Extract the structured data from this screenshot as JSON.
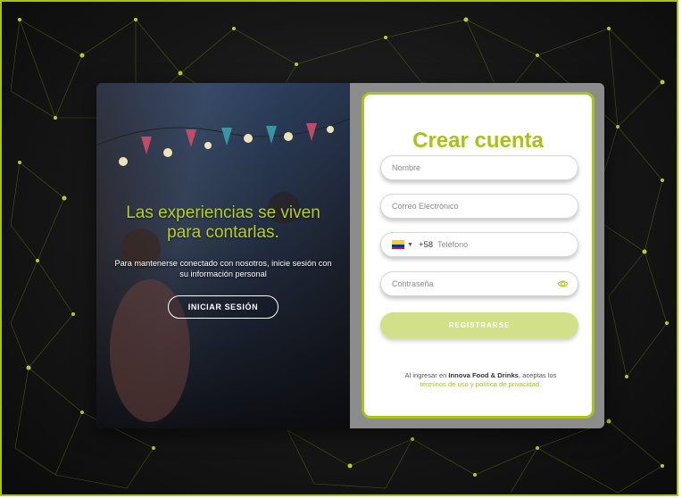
{
  "colors": {
    "accent": "#a9c21a",
    "button_disabled": "#d3e08a",
    "background": "#161616"
  },
  "hero": {
    "tagline": "Las experiencias se viven para contarlas.",
    "subtitle": "Para mantenerse conectado con nosotros, inicie sesión con su información personal",
    "login_button": "INICIAR SESIÓN"
  },
  "form": {
    "title": "Crear cuenta",
    "name_placeholder": "Nombre",
    "email_placeholder": "Correo Electrónico",
    "phone": {
      "country_icon": "venezuela-flag-icon",
      "dial_code": "+58",
      "placeholder": "Teléfono"
    },
    "password_placeholder": "Contraseña",
    "password_toggle_icon": "eye-icon",
    "register_button": "REGISTRARSE"
  },
  "terms": {
    "prefix": "Al ingresar en ",
    "brand": "Innova Food & Drinks",
    "middle": ", aceptas los",
    "link": "términos de uso y política de privacidad."
  }
}
